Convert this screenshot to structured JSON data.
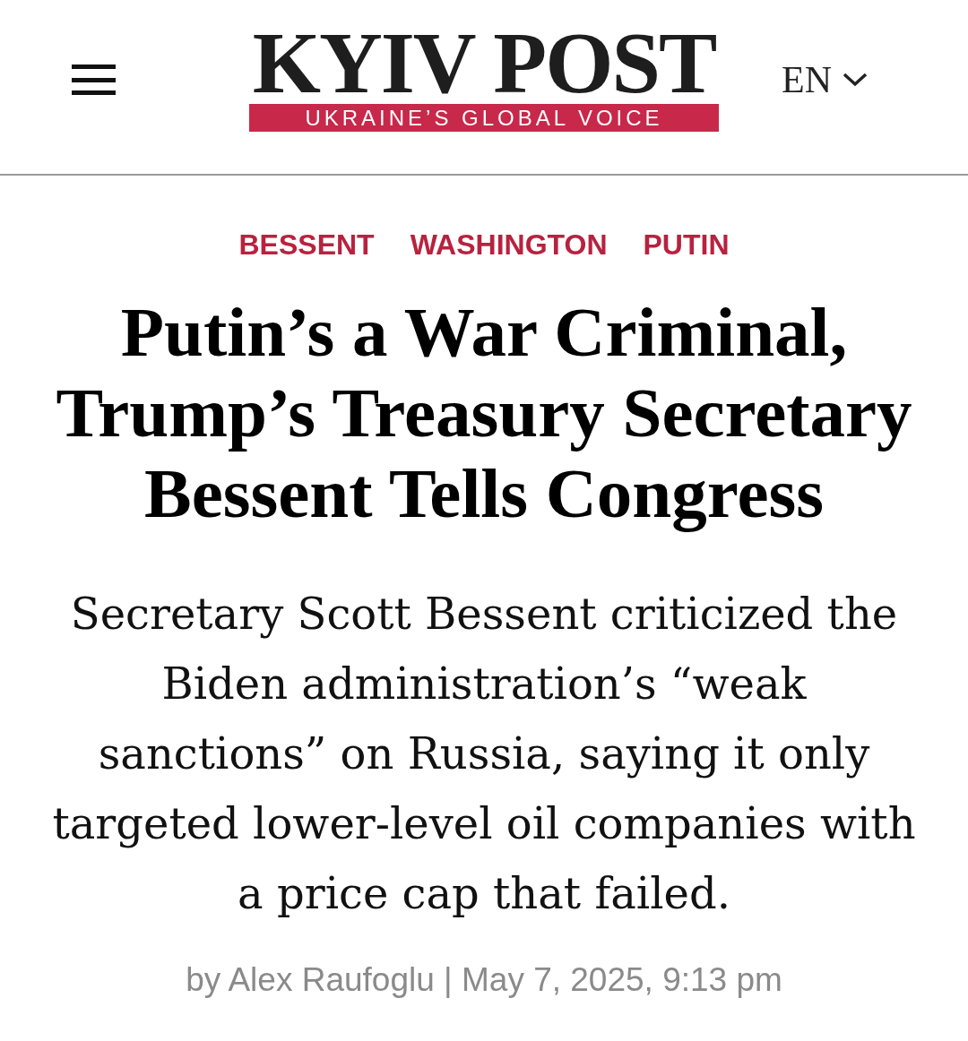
{
  "header": {
    "logo": {
      "title": "KYIV POST",
      "tagline": "UKRAINE’S GLOBAL VOICE"
    },
    "language": {
      "label": "EN"
    }
  },
  "article": {
    "tags": [
      "BESSENT",
      "WASHINGTON",
      "PUTIN"
    ],
    "headline": "Putin’s a War Criminal, Trump’s Treasury Secretary Bessent Tells Congress",
    "summary": "Secretary Scott Bessent criticized the Biden administration’s “weak sanctions” on Russia, saying it only targeted lower-level oil companies with a price cap that failed.",
    "byline": "by Alex Raufoglu | May 7, 2025, 9:13 pm"
  }
}
